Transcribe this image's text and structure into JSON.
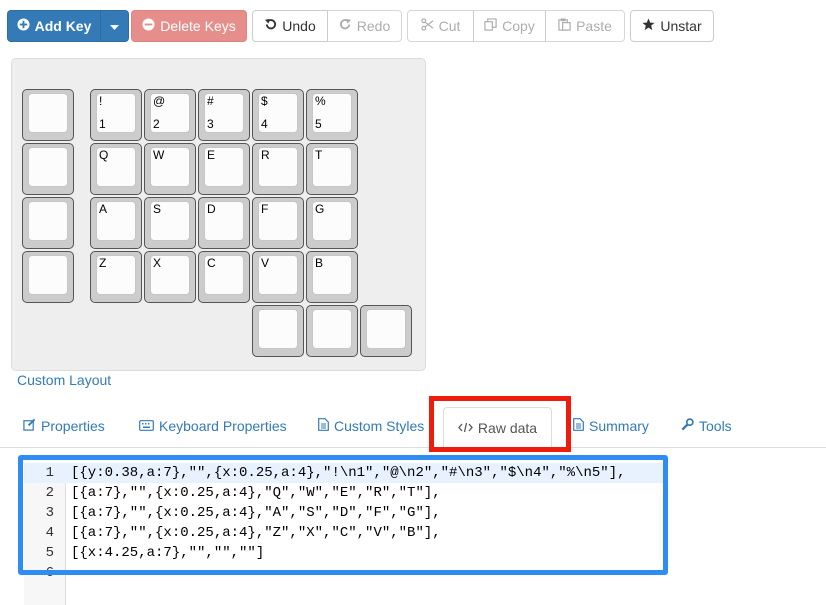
{
  "toolbar": {
    "add_key": "Add Key",
    "delete_keys": "Delete Keys",
    "undo": "Undo",
    "redo": "Redo",
    "cut": "Cut",
    "copy": "Copy",
    "paste": "Paste",
    "unstar": "Unstar"
  },
  "keys": [
    {
      "l1": "",
      "l2": ""
    },
    {
      "l1": "!",
      "l2": "1"
    },
    {
      "l1": "@",
      "l2": "2"
    },
    {
      "l1": "#",
      "l2": "3"
    },
    {
      "l1": "$",
      "l2": "4"
    },
    {
      "l1": "%",
      "l2": "5"
    },
    {
      "l1": "",
      "l2": ""
    },
    {
      "l1": "Q",
      "l2": ""
    },
    {
      "l1": "W",
      "l2": ""
    },
    {
      "l1": "E",
      "l2": ""
    },
    {
      "l1": "R",
      "l2": ""
    },
    {
      "l1": "T",
      "l2": ""
    },
    {
      "l1": "",
      "l2": ""
    },
    {
      "l1": "A",
      "l2": ""
    },
    {
      "l1": "S",
      "l2": ""
    },
    {
      "l1": "D",
      "l2": ""
    },
    {
      "l1": "F",
      "l2": ""
    },
    {
      "l1": "G",
      "l2": ""
    },
    {
      "l1": "",
      "l2": ""
    },
    {
      "l1": "Z",
      "l2": ""
    },
    {
      "l1": "X",
      "l2": ""
    },
    {
      "l1": "C",
      "l2": ""
    },
    {
      "l1": "V",
      "l2": ""
    },
    {
      "l1": "B",
      "l2": ""
    },
    {
      "l1": "",
      "l2": ""
    },
    {
      "l1": "",
      "l2": ""
    },
    {
      "l1": "",
      "l2": ""
    }
  ],
  "layout_name": "Custom Layout",
  "tabs": {
    "properties": "Properties",
    "keyboard_properties": "Keyboard Properties",
    "custom_styles": "Custom Styles",
    "raw_data": "Raw data",
    "summary": "Summary",
    "tools": "Tools"
  },
  "active_tab": "Raw data",
  "editor": {
    "line_numbers": [
      "1",
      "2",
      "3",
      "4",
      "5",
      "6"
    ],
    "lines": [
      "[{y:0.38,a:7},\"\",{x:0.25,a:4},\"!\\n1\",\"@\\n2\",\"#\\n3\",\"$\\n4\",\"%\\n5\"],",
      "[{a:7},\"\",{x:0.25,a:4},\"Q\",\"W\",\"E\",\"R\",\"T\"],",
      "[{a:7},\"\",{x:0.25,a:4},\"A\",\"S\",\"D\",\"F\",\"G\"],",
      "[{a:7},\"\",{x:0.25,a:4},\"Z\",\"X\",\"C\",\"V\",\"B\"],",
      "[{x:4.25,a:7},\"\",\"\",\"\"]",
      ""
    ]
  },
  "colors": {
    "primary": "#337ab7",
    "danger": "#d9534f",
    "highlight_red": "#ee1c0c",
    "highlight_blue": "#2e8cf2"
  }
}
